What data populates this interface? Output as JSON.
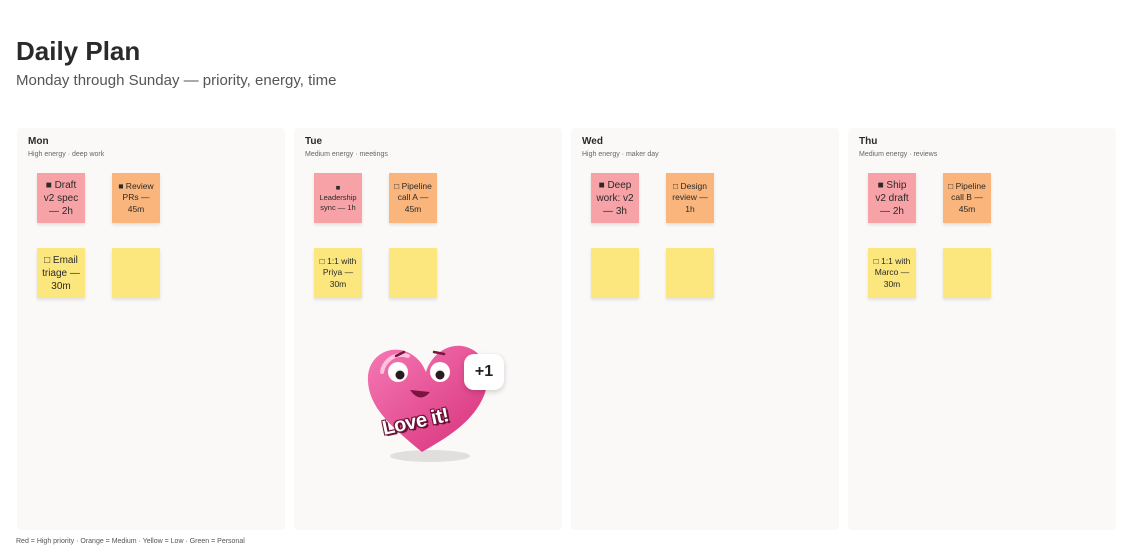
{
  "header": {
    "title": "Daily Plan",
    "subtitle": "Monday through Sunday — priority, energy, time"
  },
  "columns": [
    {
      "name": "Mon",
      "subtitle": "High energy · deep work",
      "stickies": [
        {
          "text": "■ Draft v2 spec — 2h",
          "color": "red"
        },
        {
          "text": "■ Review PRs — 45m",
          "color": "orange"
        },
        {
          "text": "□ Email triage — 30m",
          "color": "yellow"
        },
        {
          "text": "",
          "color": "yellow"
        }
      ]
    },
    {
      "name": "Tue",
      "subtitle": "Medium energy · meetings",
      "stickies": [
        {
          "text": "■ Leadership sync — 1h",
          "color": "red"
        },
        {
          "text": "□ Pipeline call A — 45m",
          "color": "orange"
        },
        {
          "text": "□ 1:1 with Priya — 30m",
          "color": "yellow"
        },
        {
          "text": "",
          "color": "yellow"
        }
      ]
    },
    {
      "name": "Wed",
      "subtitle": "High energy · maker day",
      "stickies": [
        {
          "text": "■ Deep work: v2 — 3h",
          "color": "red"
        },
        {
          "text": "□ Design review — 1h",
          "color": "orange"
        },
        {
          "text": "",
          "color": "yellow"
        },
        {
          "text": "",
          "color": "yellow"
        }
      ]
    },
    {
      "name": "Thu",
      "subtitle": "Medium energy · reviews",
      "stickies": [
        {
          "text": "■ Ship v2 draft — 2h",
          "color": "red"
        },
        {
          "text": "□ Pipeline call B — 45m",
          "color": "orange"
        },
        {
          "text": "□ 1:1 with Marco — 30m",
          "color": "yellow"
        },
        {
          "text": "",
          "color": "yellow"
        }
      ]
    }
  ],
  "reaction": {
    "icon": "heart-sticker-icon",
    "label": "Love it!",
    "count": "+1"
  },
  "legend": "Red = High priority · Orange = Medium · Yellow = Low · Green = Personal",
  "colors": {
    "red": "#f7a2a6",
    "orange": "#f9b57c",
    "yellow": "#fce77f",
    "column_bg": "#fbf9f8",
    "heart": "#ec4f95"
  }
}
